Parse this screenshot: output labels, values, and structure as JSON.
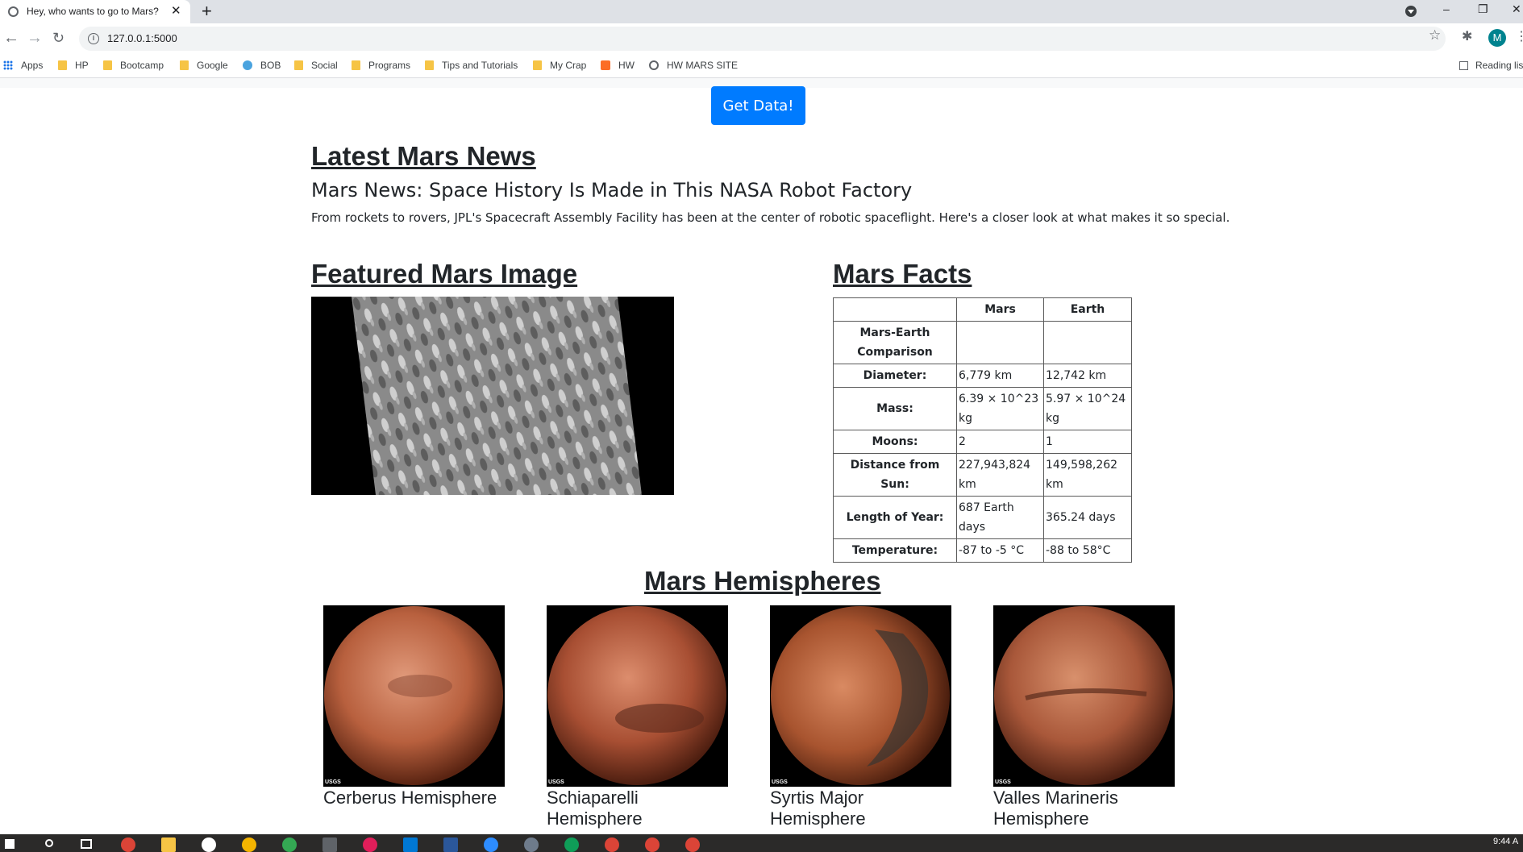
{
  "browser": {
    "tab_title": "Hey, who wants to go to Mars?",
    "tab_close": "✕",
    "new_tab": "+",
    "url": "127.0.0.1:5000",
    "avatar_letter": "M",
    "window_controls": [
      "–",
      "❐",
      "✕"
    ],
    "bookmarks": [
      "Apps",
      "HP",
      "Bootcamp",
      "Google",
      "BOB",
      "Social",
      "Programs",
      "Tips and Tutorials",
      "My Crap",
      "HW",
      "HW MARS SITE"
    ],
    "reading_list": "Reading lis"
  },
  "page": {
    "button_label": "Get Data!",
    "news": {
      "heading": "Latest Mars News",
      "title": "Mars News: Space History Is Made in This NASA Robot Factory",
      "teaser": "From rockets to rovers, JPL's Spacecraft Assembly Facility has been at the center of robotic spaceflight. Here's a closer look at what makes it so special."
    },
    "featured_heading": "Featured Mars Image",
    "facts": {
      "heading": "Mars Facts",
      "columns": [
        "",
        "Mars",
        "Earth"
      ],
      "rows": [
        {
          "label": "Mars-Earth Comparison",
          "mars": "",
          "earth": ""
        },
        {
          "label": "Diameter:",
          "mars": "6,779 km",
          "earth": "12,742 km"
        },
        {
          "label": "Mass:",
          "mars": "6.39 × 10^23 kg",
          "earth": "5.97 × 10^24 kg"
        },
        {
          "label": "Moons:",
          "mars": "2",
          "earth": "1"
        },
        {
          "label": "Distance from Sun:",
          "mars": "227,943,824 km",
          "earth": "149,598,262 km"
        },
        {
          "label": "Length of Year:",
          "mars": "687 Earth days",
          "earth": "365.24 days"
        },
        {
          "label": "Temperature:",
          "mars": "-87 to -5 °C",
          "earth": "-88 to 58°C"
        }
      ]
    },
    "hemispheres": {
      "heading": "Mars Hemispheres",
      "items": [
        {
          "name": "Cerberus Hemisphere",
          "badge": "USGS"
        },
        {
          "name": "Schiaparelli Hemisphere",
          "badge": "USGS"
        },
        {
          "name": "Syrtis Major Hemisphere",
          "badge": "USGS"
        },
        {
          "name": "Valles Marineris Hemisphere",
          "badge": "USGS"
        }
      ]
    }
  },
  "taskbar": {
    "clock": "9:44 A"
  },
  "colors": {
    "primary_button": "#007bff",
    "tabstrip": "#dee1e6",
    "taskbar": "#2b2a29"
  }
}
